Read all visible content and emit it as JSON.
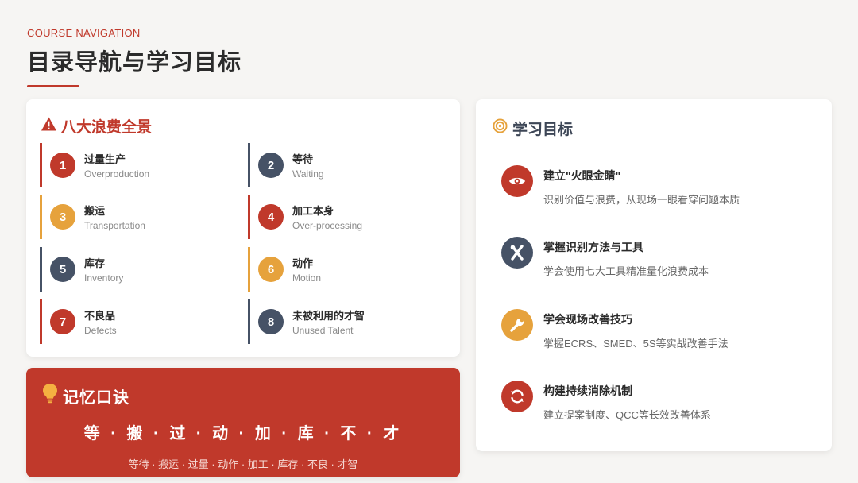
{
  "header": {
    "eyebrow": "COURSE NAVIGATION",
    "title": "目录导航与学习目标"
  },
  "waste": {
    "heading": "八大浪费全景",
    "icon": "warning-icon",
    "items": [
      {
        "num": "1",
        "title": "过量生产",
        "sub": "Overproduction",
        "color": "#c0392b"
      },
      {
        "num": "2",
        "title": "等待",
        "sub": "Waiting",
        "color": "#465266"
      },
      {
        "num": "3",
        "title": "搬运",
        "sub": "Transportation",
        "color": "#e6a23c"
      },
      {
        "num": "4",
        "title": "加工本身",
        "sub": "Over-processing",
        "color": "#c0392b"
      },
      {
        "num": "5",
        "title": "库存",
        "sub": "Inventory",
        "color": "#465266"
      },
      {
        "num": "6",
        "title": "动作",
        "sub": "Motion",
        "color": "#e6a23c"
      },
      {
        "num": "7",
        "title": "不良品",
        "sub": "Defects",
        "color": "#c0392b"
      },
      {
        "num": "8",
        "title": "未被利用的才智",
        "sub": "Unused Talent",
        "color": "#465266"
      }
    ]
  },
  "mnemonic": {
    "heading": "记忆口诀",
    "icon": "lightbulb-icon",
    "big": "等 · 搬 · 过 · 动 · 加 · 库 · 不 · 才",
    "small": "等待 · 搬运 · 过量 · 动作 · 加工 · 库存 · 不良 · 才智"
  },
  "goals": {
    "heading": "学习目标",
    "icon": "target-icon",
    "items": [
      {
        "title": "建立\"火眼金睛\"",
        "sub": "识别价值与浪费，从现场一眼看穿问题本质",
        "icon": "eye-icon",
        "color": "#c0392b"
      },
      {
        "title": "掌握识别方法与工具",
        "sub": "学会使用七大工具精准量化浪费成本",
        "icon": "tools-icon",
        "color": "#465266"
      },
      {
        "title": "学会现场改善技巧",
        "sub": "掌握ECRS、SMED、5S等实战改善手法",
        "icon": "wrench-icon",
        "color": "#e6a23c"
      },
      {
        "title": "构建持续消除机制",
        "sub": "建立提案制度、QCC等长效改善体系",
        "icon": "refresh-icon",
        "color": "#c0392b"
      }
    ]
  },
  "colors": {
    "accent": "#c0392b",
    "navy": "#465266",
    "gold": "#e6a23c"
  }
}
